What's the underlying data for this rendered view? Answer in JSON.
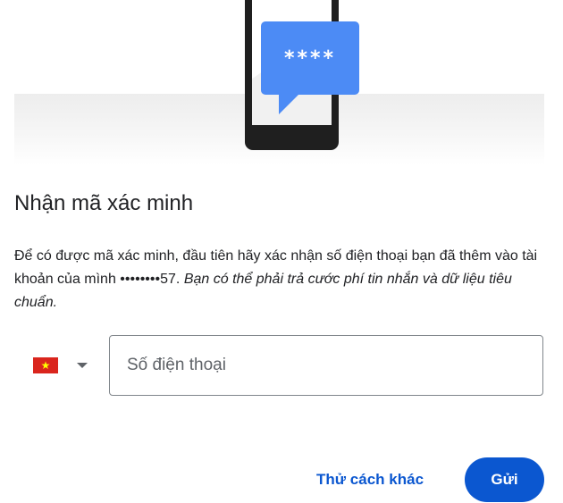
{
  "illustration": {
    "masked_code": "****"
  },
  "title": "Nhận mã xác minh",
  "description": {
    "main": "Để có được mã xác minh, đầu tiên hãy xác nhận số điện thoại bạn đã thêm vào tài khoản của mình ••••••••57.",
    "note": "Bạn có thể phải trả cước phí tin nhắn và dữ liệu tiêu chuẩn."
  },
  "country_select": {
    "flag_icon": "vietnam-flag-icon",
    "dropdown_icon": "caret-down-icon"
  },
  "phone_field": {
    "placeholder": "Số điện thoại",
    "value": ""
  },
  "actions": {
    "try_another": "Thử cách khác",
    "send": "Gửi"
  },
  "colors": {
    "primary": "#0b57d0",
    "bubble": "#4c8bf5"
  }
}
